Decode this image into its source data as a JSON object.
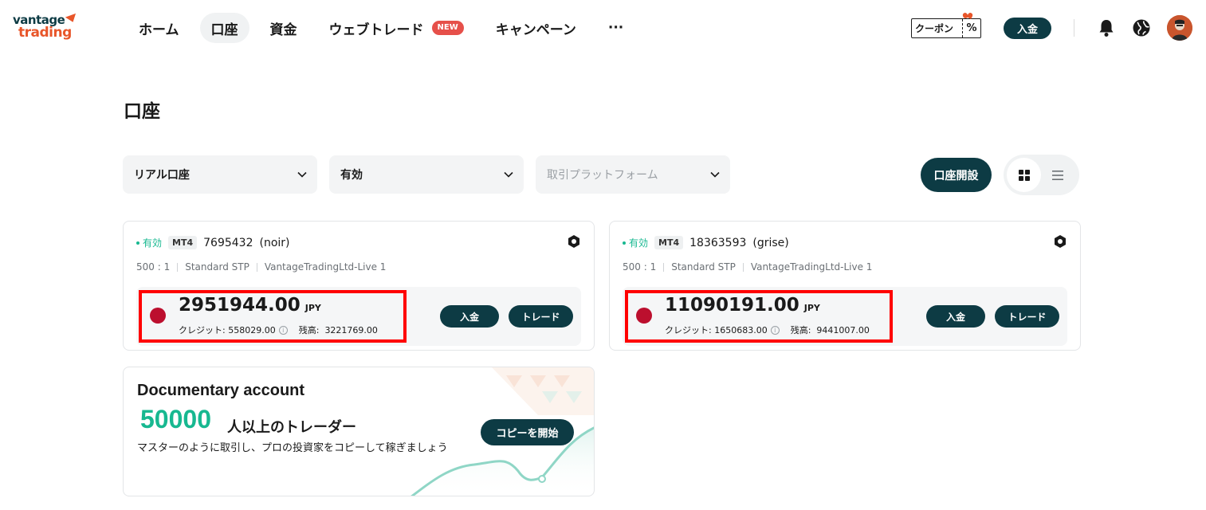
{
  "brand": {
    "line1": "vantage",
    "line2": "trading"
  },
  "nav": [
    {
      "label": "ホーム",
      "active": false
    },
    {
      "label": "口座",
      "active": true
    },
    {
      "label": "資金",
      "active": false
    },
    {
      "label": "ウェブトレード",
      "active": false,
      "badge": "NEW"
    },
    {
      "label": "キャンペーン",
      "active": false
    },
    {
      "label": "···",
      "active": false
    }
  ],
  "header": {
    "coupon_label": "クーポン",
    "coupon_symbol": "%",
    "deposit_label": "入金",
    "icons": [
      "bell-icon",
      "globe-icon"
    ]
  },
  "page": {
    "title": "口座"
  },
  "filters": {
    "account_type": "リアル口座",
    "status": "有効",
    "platform_placeholder": "取引プラットフォーム"
  },
  "actions": {
    "open_account": "口座開設",
    "view": "grid"
  },
  "accounts": [
    {
      "status": "有効",
      "platform": "MT4",
      "number": "7695432",
      "name": "(noir)",
      "leverage": "500 : 1",
      "type": "Standard STP",
      "server": "VantageTradingLtd-Live 1",
      "equity": "2951944.00",
      "currency": "JPY",
      "credit_label": "クレジット:",
      "credit": "558029.00",
      "balance_label": "残高:",
      "balance": "3221769.00",
      "deposit_label": "入金",
      "trade_label": "トレード"
    },
    {
      "status": "有効",
      "platform": "MT4",
      "number": "18363593",
      "name": "(grise)",
      "leverage": "500 : 1",
      "type": "Standard STP",
      "server": "VantageTradingLtd-Live 1",
      "equity": "11090191.00",
      "currency": "JPY",
      "credit_label": "クレジット:",
      "credit": "1650683.00",
      "balance_label": "残高:",
      "balance": "9441007.00",
      "deposit_label": "入金",
      "trade_label": "トレード"
    }
  ],
  "promo": {
    "title": "Documentary account",
    "number": "50000",
    "number_suffix": "人以上のトレーダー",
    "description": "マスターのように取引し、プロの投資家をコピーして稼ぎましょう",
    "button": "コピーを開始"
  },
  "colors": {
    "brand_dark": "#0d3b44",
    "accent_orange": "#e8562a",
    "status_green": "#17b890",
    "highlight_red": "#ff0000",
    "new_badge": "#e6504a"
  }
}
